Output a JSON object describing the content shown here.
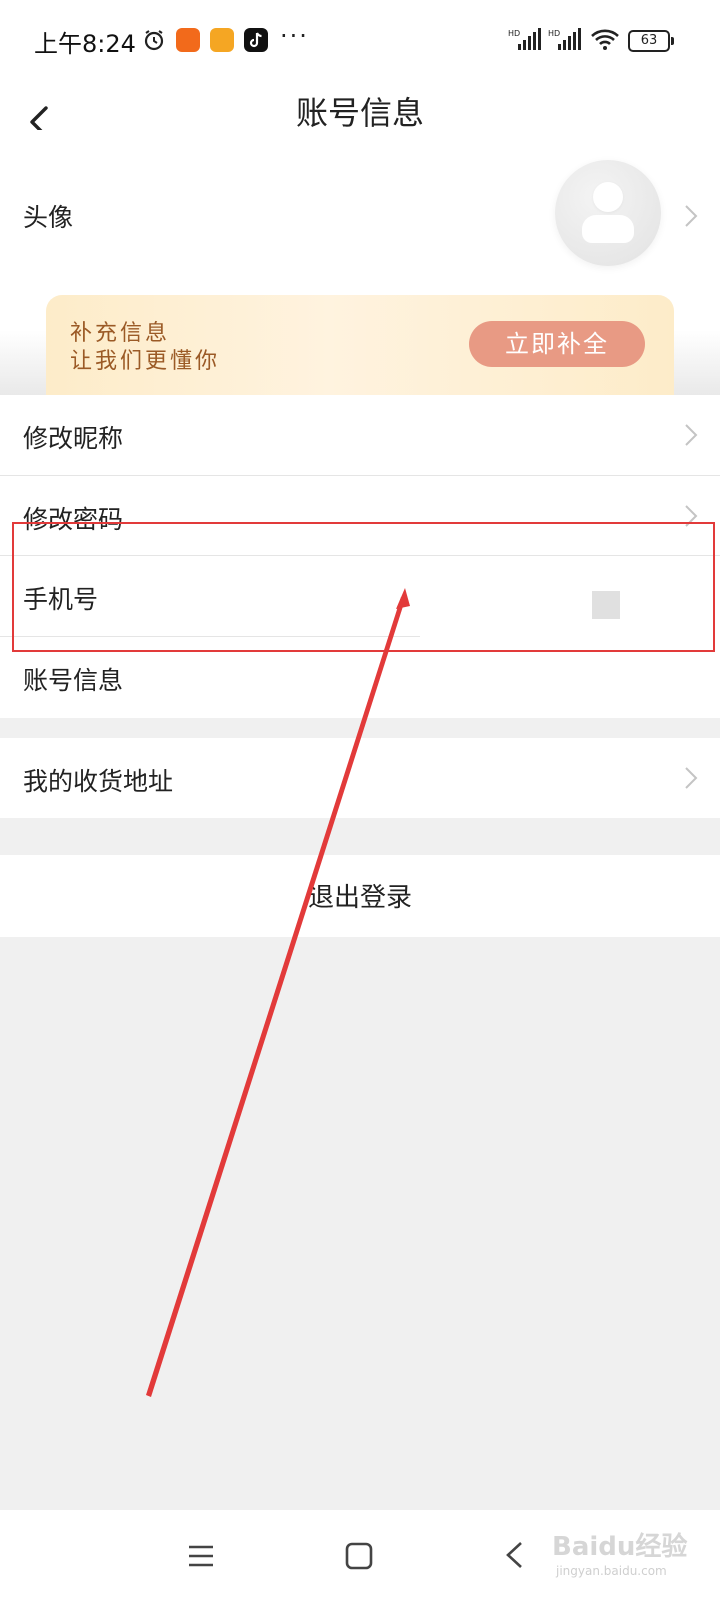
{
  "status_bar": {
    "time": "上午8:24",
    "icons": [
      "alarm-icon",
      "app-icon-kuaishou",
      "app-icon-notes",
      "app-icon-douyin",
      "more-dots-icon",
      "signal-hd-icon",
      "signal-hd-icon",
      "wifi-icon",
      "battery-icon"
    ],
    "more": "···",
    "battery_level": "63"
  },
  "header": {
    "title": "账号信息",
    "back_icon": "chevron-left-icon"
  },
  "avatar_row": {
    "label": "头像",
    "avatar_icon": "default-avatar-icon"
  },
  "banner": {
    "line1": "补充信息",
    "line2": "让我们更懂你",
    "button_label": "立即补全"
  },
  "list": {
    "items": [
      {
        "label": "修改昵称"
      },
      {
        "label": "修改密码"
      },
      {
        "label": "手机号"
      },
      {
        "label": "账号信息"
      }
    ]
  },
  "address": {
    "label": "我的收货地址"
  },
  "logout": {
    "label": "退出登录"
  },
  "nav_bar": {
    "icons": [
      "menu-icon",
      "home-icon",
      "back-icon"
    ]
  },
  "watermark": {
    "main": "Baidu经验",
    "sub": "jingyan.baidu.com"
  },
  "colors": {
    "accent_button": "#e89a84",
    "banner_text": "#9b5a26",
    "annotation_red": "#e23a3a",
    "background": "#f0f0f0"
  }
}
